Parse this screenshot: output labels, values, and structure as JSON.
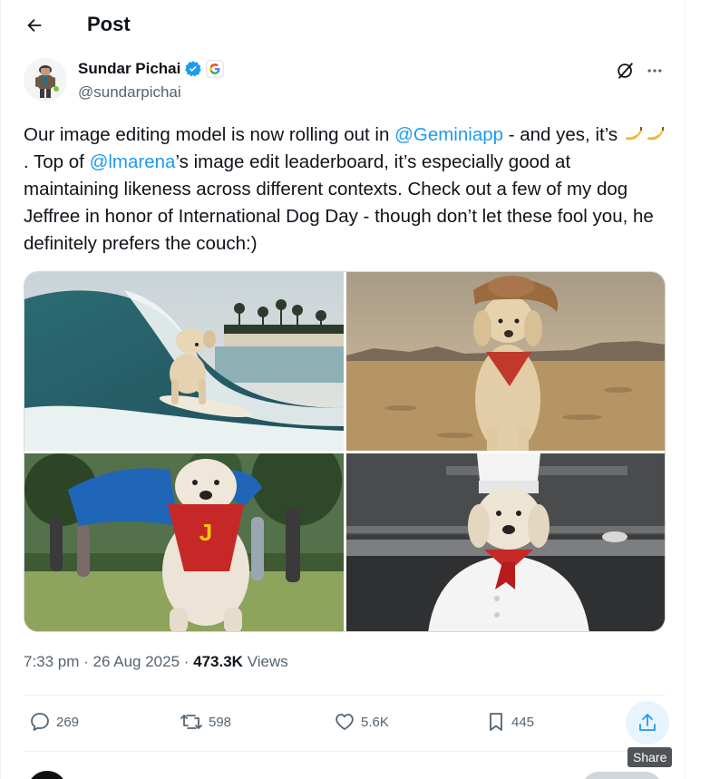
{
  "header": {
    "title": "Post"
  },
  "author": {
    "name": "Sundar Pichai",
    "handle": "@sundarpichai",
    "verified": true,
    "affiliate_badge": "google-logo"
  },
  "tweet": {
    "seg1": "Our image editing model is now rolling out in ",
    "mention1": "@Geminiapp",
    "seg2": " - and yes, it’s ",
    "seg3": ". Top of ",
    "mention2": "@lmarena",
    "seg4": "’s image edit leaderboard, it’s especially good at maintaining likeness across different contexts. Check out a few of my dog Jeffree in honor of International Dog Day - though don’t let these fool you, he definitely prefers the couch:)",
    "emoji": "banana"
  },
  "media": [
    {
      "alt": "dog-surfing"
    },
    {
      "alt": "dog-cowboy-desert"
    },
    {
      "alt": "dog-superhero-park"
    },
    {
      "alt": "dog-chef-kitchen"
    }
  ],
  "meta": {
    "time": "7:33 pm",
    "sep1": " · ",
    "date": "26 Aug 2025",
    "sep2": " · ",
    "views_count": "473.3K",
    "views_label": " Views"
  },
  "actions": {
    "replies": "269",
    "reposts": "598",
    "likes": "5.6K",
    "bookmarks": "445"
  },
  "tooltip": {
    "share": "Share"
  },
  "colors": {
    "accent": "#1d9bf0",
    "text": "#0f1419",
    "muted": "#536471"
  }
}
